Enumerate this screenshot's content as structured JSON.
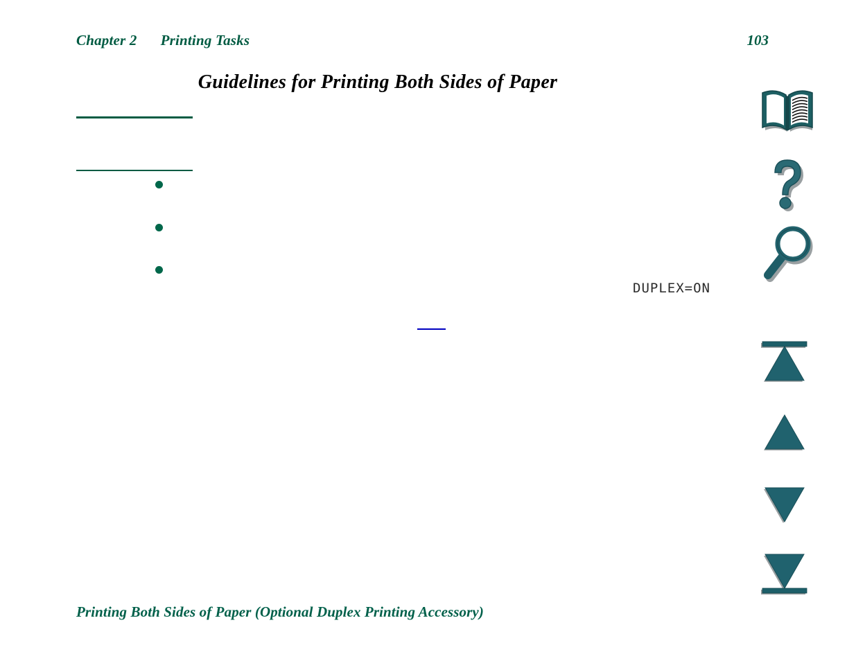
{
  "document": {
    "header": {
      "chapter_label": "Chapter 2",
      "chapter_title": "Printing Tasks",
      "page_number": "103"
    },
    "title": "Guidelines for Printing Both Sides of Paper",
    "lcd_readout": "DUPLEX=ON",
    "footer": "Printing Both Sides of Paper (Optional Duplex Printing Accessory)",
    "bullets": [
      {
        "label": ""
      },
      {
        "label": ""
      },
      {
        "label": ""
      }
    ]
  },
  "nav": {
    "items": [
      {
        "name": "book-icon",
        "tooltip": "Contents"
      },
      {
        "name": "question-mark-icon",
        "tooltip": "Help"
      },
      {
        "name": "magnifying-glass-icon",
        "tooltip": "Find"
      },
      {
        "name": "first-page-icon",
        "tooltip": "First Page"
      },
      {
        "name": "previous-page-icon",
        "tooltip": "Previous Page"
      },
      {
        "name": "next-page-icon",
        "tooltip": "Next Page"
      },
      {
        "name": "last-page-icon",
        "tooltip": "Last Page"
      }
    ]
  },
  "colors": {
    "header_green": "#005b42",
    "footer_green": "#00604a",
    "bullet_green": "#00674a",
    "rule_green": "#005b42",
    "icon_teal": "#20626e",
    "icon_teal_dark": "#16505b",
    "link_blue": "#0000c0",
    "lcd_text": "#2b2b2b",
    "title_black": "#000000",
    "page_background": "#ffffff"
  }
}
